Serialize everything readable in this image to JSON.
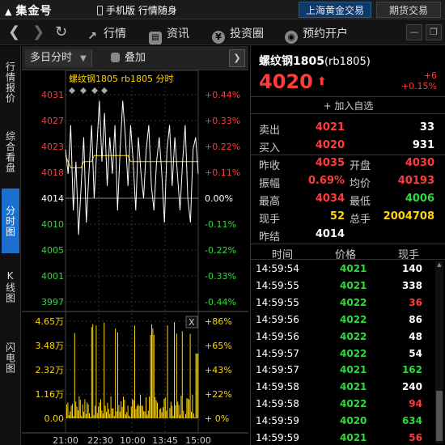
{
  "topbar": {
    "logo": "集金号",
    "phone_label": "手机版",
    "slogan": "行情随身",
    "btn_gold": "上海黄金交易",
    "btn_futures": "期货交易"
  },
  "nav": {
    "quotes": "行情",
    "info": "资讯",
    "invest": "投资圈",
    "open_account": "预约开户"
  },
  "left_tabs": [
    "行情报价",
    "综合看盘",
    "分时图",
    "K线图",
    "闪电图"
  ],
  "chart": {
    "period_label": "多日分时",
    "overlay_label": "叠加",
    "legend": "螺纹钢1805 rb1805 分时",
    "price_ticks": [
      "4031",
      "4027",
      "4023",
      "4018",
      "4014",
      "4010",
      "4005",
      "4001",
      "3997"
    ],
    "pct_ticks": [
      "+0.44%",
      "+0.33%",
      "+0.22%",
      "+0.11%",
      "0.00%",
      "-0.11%",
      "-0.22%",
      "-0.33%",
      "-0.44%"
    ],
    "vol_ticks": [
      "4.65万",
      "3.48万",
      "2.32万",
      "1.16万",
      "0.00"
    ],
    "vol_pct_ticks": [
      "+86%",
      "+65%",
      "+43%",
      "+22%",
      "+ 0%"
    ],
    "time_ticks": [
      "21:00",
      "22:30",
      "10:00",
      "13:45",
      "15:00"
    ],
    "close_btn": "X",
    "colors": {
      "up": "#ff3b3b",
      "down": "#2ddc3a",
      "neutral": "#ffffff",
      "volume": "#ffd700",
      "avg": "#ffd700"
    }
  },
  "chart_data": {
    "type": "line",
    "title": "螺纹钢1805 rb1805 分时",
    "ylim": [
      3997,
      4031
    ],
    "reference": 4014,
    "series": [
      {
        "name": "price",
        "values": [
          4022,
          4018,
          4026,
          4012,
          4020,
          4008,
          4016,
          4024,
          4010,
          4018,
          4026,
          4014,
          4022,
          4030,
          4020,
          4028,
          4016,
          4024,
          4018,
          4026,
          4012,
          4022,
          4030,
          4024,
          4016,
          4026,
          4020,
          4012,
          4024,
          4018,
          4014,
          4022,
          4026,
          4016,
          4012,
          4020,
          4024,
          4018,
          4010,
          4022,
          4026,
          4016,
          4024,
          4018,
          4012,
          4020,
          4026,
          4014,
          4010,
          4022,
          4024,
          4018
        ]
      },
      {
        "name": "avg",
        "values": [
          4021,
          4020,
          4019,
          4019,
          4019,
          4019,
          4019,
          4020,
          4020,
          4020,
          4020,
          4021,
          4021,
          4021,
          4021,
          4021,
          4021,
          4021,
          4021,
          4021,
          4021,
          4021,
          4021,
          4021,
          4021,
          4020,
          4020,
          4020,
          4020,
          4020,
          4020,
          4020,
          4020,
          4020,
          4020,
          4020,
          4020,
          4020,
          4020,
          4020,
          4020,
          4020,
          4020,
          4020,
          4020,
          4020,
          4020,
          4020,
          4020,
          4020,
          4020,
          4020
        ]
      }
    ],
    "volume_ylim": [
      0,
      46500
    ]
  },
  "quote": {
    "name": "螺纹钢1805",
    "code": "(rb1805)",
    "price": "4020",
    "arrow": "⬆",
    "change": "+6",
    "change_pct": "+0.15%",
    "add_watch": "+ 加入自选",
    "sell_label": "卖出",
    "sell_price": "4021",
    "sell_vol": "33",
    "buy_label": "买入",
    "buy_price": "4020",
    "buy_vol": "931",
    "prev_close_label": "昨收",
    "prev_close": "4035",
    "open_label": "开盘",
    "open": "4030",
    "amp_label": "振幅",
    "amp": "0.69%",
    "avg_label": "均价",
    "avg": "40193",
    "high_label": "最高",
    "high": "4034",
    "low_label": "最低",
    "low": "4006",
    "cur_vol_label": "现手",
    "cur_vol": "52",
    "total_label": "总手",
    "total": "2004708",
    "prev_settle_label": "昨结",
    "prev_settle": "4014"
  },
  "ticks_header": {
    "time": "时间",
    "price": "价格",
    "vol": "现手"
  },
  "ticks": [
    {
      "time": "14:59:54",
      "price": "4021",
      "pc": "green",
      "vol": "140",
      "vc": "white"
    },
    {
      "time": "14:59:55",
      "price": "4021",
      "pc": "green",
      "vol": "338",
      "vc": "white"
    },
    {
      "time": "14:59:55",
      "price": "4022",
      "pc": "green",
      "vol": "36",
      "vc": "red"
    },
    {
      "time": "14:59:56",
      "price": "4022",
      "pc": "green",
      "vol": "86",
      "vc": "white"
    },
    {
      "time": "14:59:56",
      "price": "4022",
      "pc": "green",
      "vol": "48",
      "vc": "white"
    },
    {
      "time": "14:59:57",
      "price": "4022",
      "pc": "green",
      "vol": "54",
      "vc": "white"
    },
    {
      "time": "14:59:57",
      "price": "4021",
      "pc": "green",
      "vol": "162",
      "vc": "green"
    },
    {
      "time": "14:59:58",
      "price": "4021",
      "pc": "green",
      "vol": "240",
      "vc": "white"
    },
    {
      "time": "14:59:58",
      "price": "4022",
      "pc": "green",
      "vol": "94",
      "vc": "red"
    },
    {
      "time": "14:59:59",
      "price": "4020",
      "pc": "green",
      "vol": "634",
      "vc": "green"
    },
    {
      "time": "14:59:59",
      "price": "4021",
      "pc": "green",
      "vol": "56",
      "vc": "red"
    }
  ]
}
